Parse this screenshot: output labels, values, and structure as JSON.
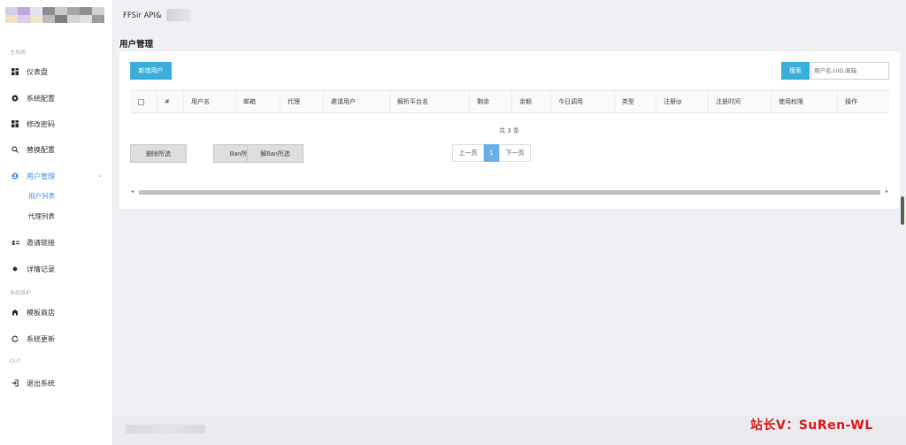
{
  "sidebar": {
    "section_main": "主系统",
    "section_dev": "系统维护",
    "section_out": "OUT",
    "items": [
      {
        "label": "仪表盘",
        "icon": "dashboard-icon"
      },
      {
        "label": "系统配置",
        "icon": "settings-icon"
      },
      {
        "label": "修改密码",
        "icon": "key-icon"
      },
      {
        "label": "替换配置",
        "icon": "replace-icon"
      },
      {
        "label": "用户管理",
        "icon": "user-icon"
      },
      {
        "label": "邀请链接",
        "icon": "invite-icon"
      },
      {
        "label": "详情记录",
        "icon": "record-icon"
      },
      {
        "label": "模板商店",
        "icon": "store-icon"
      },
      {
        "label": "系统更新",
        "icon": "update-icon"
      },
      {
        "label": "退出系统",
        "icon": "logout-icon"
      }
    ],
    "sub_items": [
      "用户列表",
      "代理列表"
    ]
  },
  "header": {
    "brand": "FFSir API&"
  },
  "page": {
    "title": "用户管理"
  },
  "toolbar": {
    "add_user": "新增用户",
    "search_button": "搜索",
    "search_placeholder": "用户名,UID,邮箱"
  },
  "table": {
    "columns": [
      "#",
      "用户名",
      "邮箱",
      "代理",
      "邀请用户",
      "解析平台名",
      "剩余",
      "余额",
      "今日调用",
      "类型",
      "注册ip",
      "注册时间",
      "使用权限",
      "操作"
    ],
    "total_text": "共 3 条"
  },
  "actions": {
    "delete_selected": "删除所选",
    "ban_selected": "Ban所选",
    "unban_selected": "解Ban所选"
  },
  "pagination": {
    "prev": "上一页",
    "current": "1",
    "next": "下一页"
  },
  "watermark": "站长V：SuRen-WL",
  "colors": {
    "accent": "#3bafda",
    "active_nav": "#4a90e2",
    "watermark": "#e0191a"
  }
}
